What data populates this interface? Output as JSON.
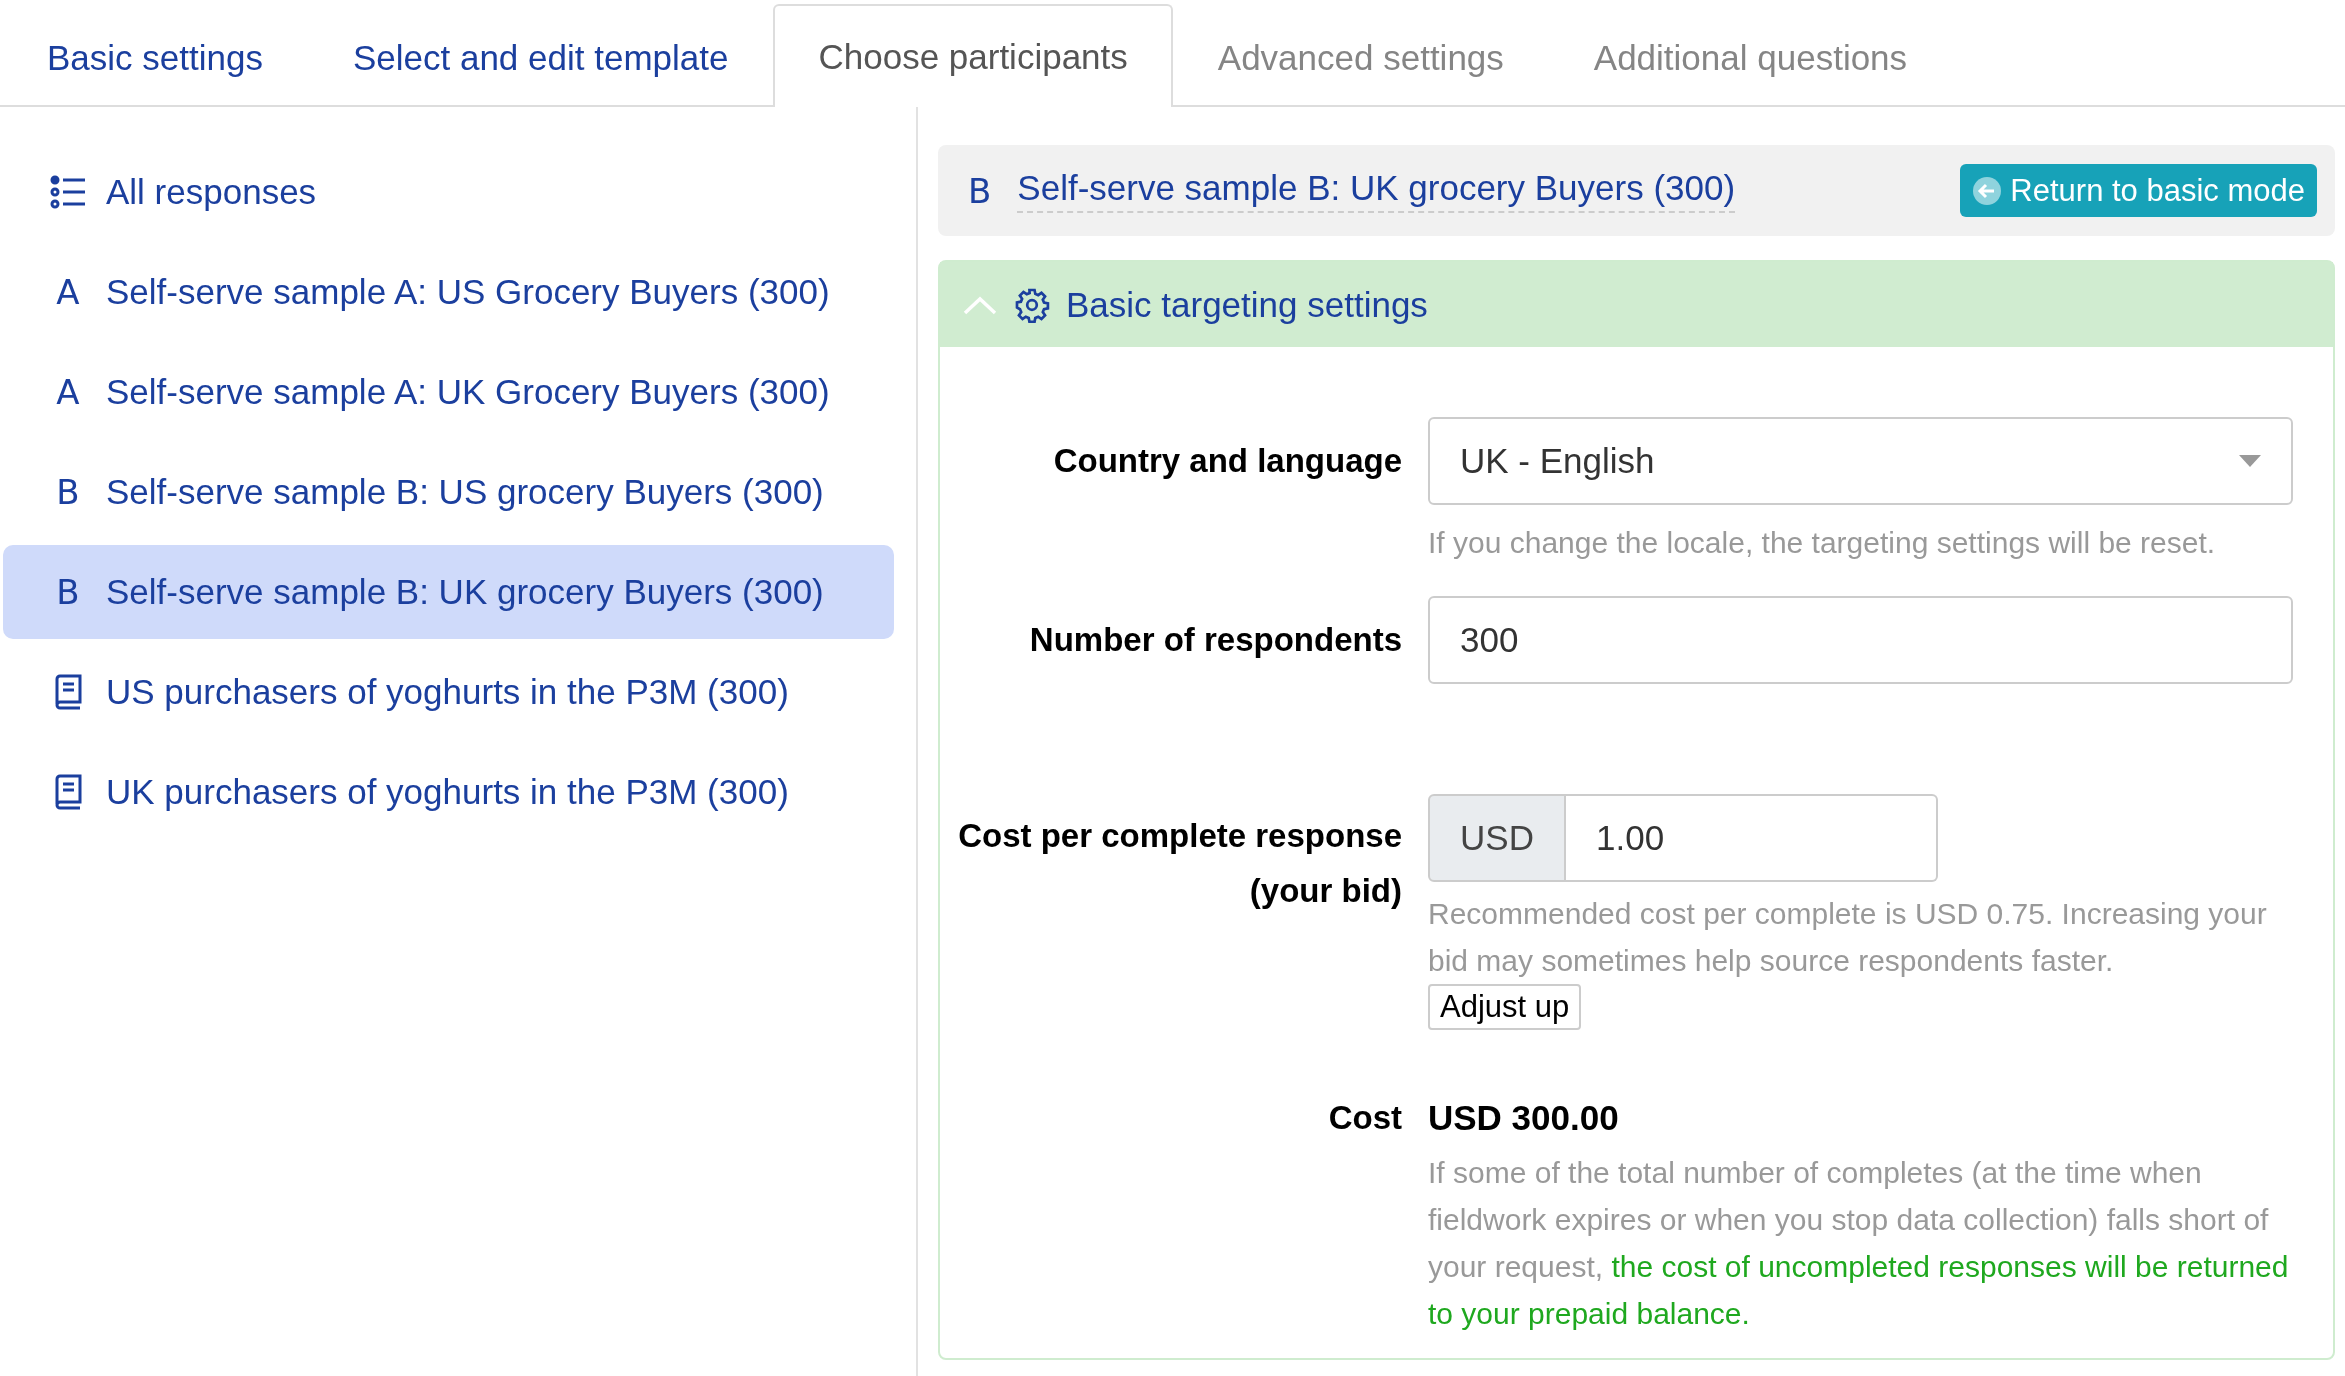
{
  "tabs": [
    {
      "label": "Basic settings",
      "selected": false,
      "disabled": false
    },
    {
      "label": "Select and edit template",
      "selected": false,
      "disabled": false
    },
    {
      "label": "Choose participants",
      "selected": true,
      "disabled": false
    },
    {
      "label": "Advanced settings",
      "selected": false,
      "disabled": true
    },
    {
      "label": "Additional questions",
      "selected": false,
      "disabled": true
    }
  ],
  "sidebar": {
    "items": [
      {
        "kind": "all",
        "label": "All responses",
        "selected": false
      },
      {
        "kind": "letter",
        "marker": "A",
        "label": "Self-serve sample A: US Grocery Buyers (300)",
        "selected": false
      },
      {
        "kind": "letter",
        "marker": "A",
        "label": "Self-serve sample A: UK Grocery Buyers (300)",
        "selected": false
      },
      {
        "kind": "letter",
        "marker": "B",
        "label": "Self-serve sample B: US grocery Buyers (300)",
        "selected": false
      },
      {
        "kind": "letter",
        "marker": "B",
        "label": "Self-serve sample B: UK grocery Buyers (300)",
        "selected": true
      },
      {
        "kind": "book",
        "label": "US purchasers of yoghurts in the P3M (300)",
        "selected": false
      },
      {
        "kind": "book",
        "label": "UK purchasers of yoghurts in the P3M (300)",
        "selected": false
      }
    ]
  },
  "header": {
    "marker": "B",
    "title": "Self-serve sample B: UK grocery Buyers (300)",
    "button": "Return to basic mode"
  },
  "section": {
    "title": "Basic targeting settings",
    "expanded": true,
    "fields": [
      {
        "kind": "select",
        "label": "Country and language",
        "value": "UK - English",
        "help": "If you change the locale, the targeting settings will be reset."
      },
      {
        "kind": "text",
        "label": "Number of respondents",
        "value": "300"
      },
      {
        "kind": "money",
        "label": "Cost per complete response (your bid)",
        "addon": "USD",
        "value": "1.00",
        "help": "Recommended cost per complete is USD 0.75. Increasing your bid may sometimes help source respondents faster.",
        "button": "Adjust up"
      },
      {
        "kind": "total",
        "label": "Cost",
        "value": "USD 300.00",
        "help": "If some of the total number of completes (at the time when fieldwork expires or when you stop data collection) falls short of your request, ",
        "help_highlight": "the cost of uncompleted responses will be returned to your prepaid balance."
      }
    ]
  }
}
